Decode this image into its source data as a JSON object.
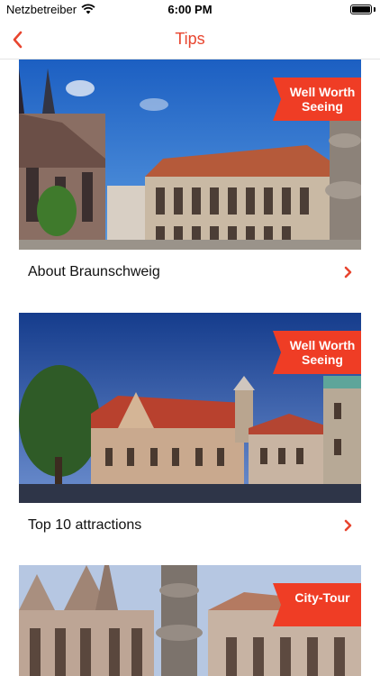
{
  "status_bar": {
    "carrier": "Netzbetreiber",
    "time": "6:00 PM"
  },
  "nav": {
    "title": "Tips",
    "back_icon": "chevron-left-icon",
    "accent_color": "#e8452f"
  },
  "cards": [
    {
      "title": "About Braunschweig",
      "badge": "Well Worth Seeing"
    },
    {
      "title": "Top 10 attractions",
      "badge": "Well Worth Seeing"
    },
    {
      "title": "",
      "badge": "City-Tour"
    }
  ],
  "colors": {
    "ribbon": "#ef3d25",
    "chevron": "#e8452f"
  }
}
